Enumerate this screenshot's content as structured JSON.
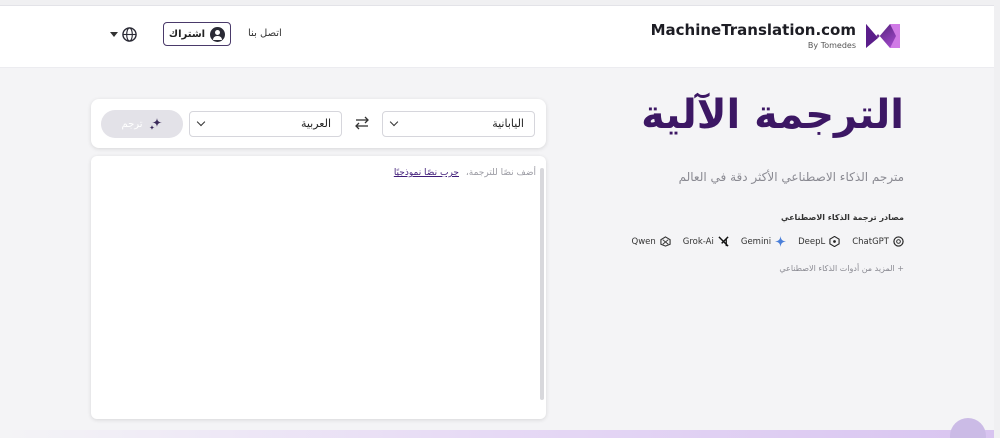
{
  "header": {
    "brand_name": "MachineTranslation.com",
    "brand_sub": "By Tomedes",
    "contact_label": "اتصل بنا",
    "signup_label": "اشتراك",
    "logo_icon": "mt-logo-icon",
    "globe_icon": "globe-icon",
    "user_icon": "user-icon"
  },
  "hero": {
    "title": "الترجمة الآلية",
    "subtitle": "مترجم الذكاء الاصطناعي الأكثر دقة في العالم",
    "sources_title": "مصادر ترجمة الذكاء الاصطناعي",
    "sources": [
      {
        "name": "ChatGPT",
        "icon": "chatgpt-icon"
      },
      {
        "name": "DeepL",
        "icon": "deepl-icon"
      },
      {
        "name": "Gemini",
        "icon": "gemini-icon"
      },
      {
        "name": "Grok-Ai",
        "icon": "grok-icon"
      },
      {
        "name": "Qwen",
        "icon": "qwen-icon"
      }
    ],
    "more_tools": "+ المزيد من أدوات الذكاء الاصطناعي"
  },
  "translator": {
    "source_language": "اليابانية",
    "target_language": "العربية",
    "translate_label": "ترجم",
    "placeholder": "أضف نصًا للترجمة،",
    "sample_link": "جرب نصًا نموذجيًا"
  },
  "colors": {
    "brand_purple": "#3c1764",
    "accent_purple": "#8a3fd1",
    "muted_gray": "#8a8a92"
  }
}
